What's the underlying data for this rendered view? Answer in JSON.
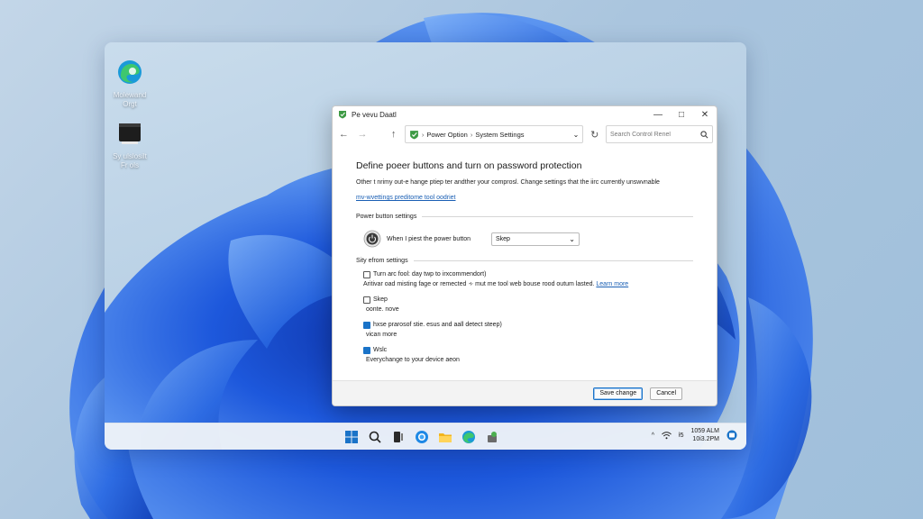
{
  "desktop_icons": [
    {
      "label": "Molewand\nOrgt",
      "icon": "edge-icon"
    },
    {
      "label": "Sy ulslosilt\nFr ols",
      "icon": "terminal-icon"
    }
  ],
  "dialog": {
    "title": "Pe vevu Daatl",
    "address": {
      "crumb1": "Power Option",
      "separator": "›",
      "crumb2": "System Settings"
    },
    "search_placeholder": "Search Control Renel",
    "heading": "Define poeer buttons and turn on password protection",
    "description": "Other t nrimy out-e hange ptiep ter andther your comprosl. Change settings that the iirc currently unswvnable",
    "change_link": "mv-wvettings preditome tool oodriet",
    "power_section": {
      "title": "Power button settings",
      "row_label": "When I piest the power button",
      "selected": "Skep"
    },
    "shutdown_section": {
      "title": "Sity efrom settings",
      "options": [
        {
          "label": "Turn arc fool: day twp to irxcommendort)",
          "sub": "Aritivar oad misting fage or remected   ∻ mut me tool web bouse rood outum lasted.",
          "link": "Learn more",
          "checked": false
        },
        {
          "label": "Skep",
          "sub": "oonte. nove",
          "checked": false
        },
        {
          "label": "hxse prarosof stie. esus and aall detect steep)",
          "sub": "vican more",
          "checked": true
        },
        {
          "label": "Wslc",
          "sub": "Everychange to your device aeon",
          "checked": true
        }
      ]
    },
    "buttons": {
      "save": "Save change",
      "cancel": "Cancel"
    }
  },
  "taskbar": {
    "apps": [
      "windows-start-icon",
      "search-icon",
      "task-view-icon",
      "edge-icon",
      "file-explorer-icon",
      "edge-icon",
      "app-icon"
    ],
    "tray": {
      "chevron": "^",
      "volume": "ł5",
      "time": "1059 ALM",
      "date": "10i3.2PM"
    }
  },
  "colors": {
    "accent": "#1a73c8",
    "wallpaper_blue": "#1e5fd8",
    "link": "#1a5fb4"
  }
}
